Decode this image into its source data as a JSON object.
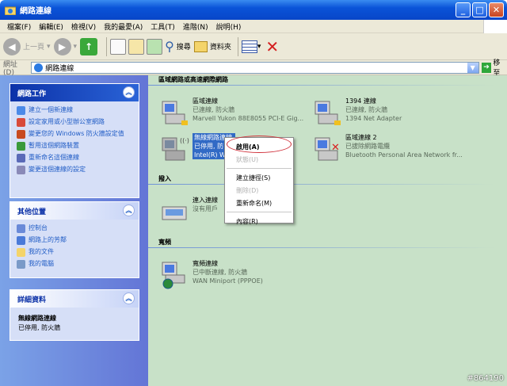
{
  "window": {
    "title": "網路連線",
    "buttons": [
      "_",
      "□",
      "✕"
    ]
  },
  "menubar": {
    "items": [
      "檔案(F)",
      "編輯(E)",
      "檢視(V)",
      "我的最愛(A)",
      "工具(T)",
      "進階(N)",
      "說明(H)"
    ]
  },
  "toolbar": {
    "back_label": "上一頁",
    "search_label": "搜尋",
    "folders_label": "資料夾"
  },
  "address": {
    "label": "網址(D)",
    "value": "網路連線",
    "go_label": "移至"
  },
  "sidebar": {
    "network_tasks": {
      "title": "網路工作",
      "items": [
        "建立一個新連線",
        "設定家用或小型辦公室網路",
        "變更您的 Windows 防火牆設定值",
        "暫用這個網路裝置",
        "重新命名這個連線",
        "變更這個連線的設定"
      ]
    },
    "other_places": {
      "title": "其他位置",
      "items": [
        "控制台",
        "網路上的芳鄰",
        "我的文件",
        "我的電腦"
      ]
    },
    "details": {
      "title": "詳細資料",
      "name": "無線網路連線",
      "status": "已停用, 防火牆"
    }
  },
  "groups": {
    "lan": "區域網路或高速網際網路",
    "dialup": "撥入",
    "broadband": "寬頻"
  },
  "connections": {
    "lan1": {
      "name": "區域連線",
      "status": "已連線, 防火牆",
      "device": "Marvell Yukon 88E8055 PCI-E Gig..."
    },
    "ieee1394": {
      "name": "1394 連線",
      "status": "已連線, 防火牆",
      "device": "1394 Net Adapter"
    },
    "wireless": {
      "name": "無線網路連線",
      "status": "已停用, 防",
      "device": "Intel(R) Wi..."
    },
    "lan2": {
      "name": "區域連線 2",
      "status": "已拔除網路電纜",
      "device": "Bluetooth Personal Area Network fr..."
    },
    "incoming": {
      "name": "連入連線",
      "status": "沒有用戶"
    },
    "broadband": {
      "name": "寬頻連線",
      "status": "已中斷連線, 防火牆",
      "device": "WAN Miniport (PPPOE)"
    }
  },
  "context_menu": {
    "items": [
      {
        "label": "啟用(A)",
        "disabled": false,
        "bold": true
      },
      {
        "label": "狀態(U)",
        "disabled": true,
        "bold": false
      },
      {
        "label": "建立捷徑(S)",
        "disabled": false,
        "bold": false
      },
      {
        "label": "刪除(D)",
        "disabled": true,
        "bold": false
      },
      {
        "label": "重新命名(M)",
        "disabled": false,
        "bold": false
      },
      {
        "label": "內容(R)",
        "disabled": false,
        "bold": false
      }
    ]
  },
  "watermark": "#864190"
}
